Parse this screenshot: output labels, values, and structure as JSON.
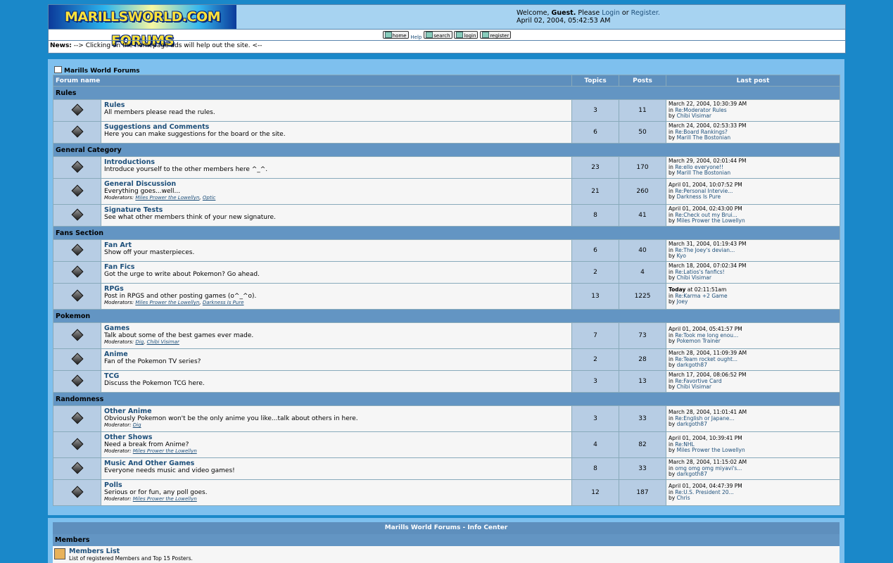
{
  "header": {
    "logo_text": "MARILLSWORLD.COM FORUMS",
    "welcome_prefix": "Welcome,",
    "guest": "Guest.",
    "please": "Please",
    "login": "Login",
    "or": "or",
    "register": "Register.",
    "date": "April 02, 2004, 05:42:53 AM"
  },
  "toolbar": {
    "home": "home",
    "help": "Help",
    "search": "search",
    "login": "login",
    "register": "register"
  },
  "news": {
    "label": "News:",
    "text": "--> Clicking on the homepage ads will help out the site. <--"
  },
  "board": {
    "title": "Marills World Forums",
    "columns": {
      "name": "Forum name",
      "topics": "Topics",
      "posts": "Posts",
      "last": "Last post"
    },
    "categories": [
      {
        "name": "Rules",
        "forums": [
          {
            "name": "Rules",
            "desc": "All members please read the rules.",
            "topics": "3",
            "posts": "11",
            "last_date": "March 22, 2004, 10:30:39 AM",
            "last_in": "Re:Moderator Rules",
            "last_by": "Chibi Visimar"
          },
          {
            "name": "Suggestions and Comments",
            "desc": "Here you can make suggestions for the board or the site.",
            "topics": "6",
            "posts": "50",
            "last_date": "March 24, 2004, 02:53:33 PM",
            "last_in": "Re:Board Rankings?",
            "last_by": "Marill The Bostonian"
          }
        ]
      },
      {
        "name": "General Category",
        "forums": [
          {
            "name": "Introductions",
            "desc": "Introduce yourself to the other members here ^_^.",
            "topics": "23",
            "posts": "170",
            "last_date": "March 29, 2004, 02:01:44 PM",
            "last_in": "Re:ello everyone!!",
            "last_by": "Marill The Bostonian"
          },
          {
            "name": "General Discussion",
            "desc": "Everything goes...well...",
            "mod_label": "Moderators:",
            "mods": [
              "Miles Prower the Lowellyn",
              "Optic"
            ],
            "topics": "21",
            "posts": "260",
            "last_date": "April 01, 2004, 10:07:52 PM",
            "last_in": "Re:Personal Intervie...",
            "last_by": "Darkness Is Pure"
          },
          {
            "name": "Signature Tests",
            "desc": "See what other members think of your new signature.",
            "topics": "8",
            "posts": "41",
            "last_date": "April 01, 2004, 02:43:00 PM",
            "last_in": "Re:Check out my Brui...",
            "last_by": "Miles Prower the Lowellyn"
          }
        ]
      },
      {
        "name": "Fans Section",
        "forums": [
          {
            "name": "Fan Art",
            "desc": "Show off your masterpieces.",
            "topics": "6",
            "posts": "40",
            "last_date": "March 31, 2004, 01:19:43 PM",
            "last_in": "Re:The Joey's devian...",
            "last_by": "Kyo"
          },
          {
            "name": "Fan Fics",
            "desc": "Got the urge to write about Pokemon? Go ahead.",
            "topics": "2",
            "posts": "4",
            "last_date": "March 18, 2004, 07:02:34 PM",
            "last_in": "Re:Latios's fanfics!",
            "last_by": "Chibi Visimar"
          },
          {
            "name": "RPGs",
            "desc": "Post in RPGS and other posting games (o^_^o).",
            "mod_label": "Moderators:",
            "mods": [
              "Miles Prower the Lowellyn",
              "Darkness Is Pure"
            ],
            "topics": "13",
            "posts": "1225",
            "last_today": "Today",
            "last_date": "at 02:11:51am",
            "last_in": "Re:Karma +2 Game",
            "last_by": "Joey"
          }
        ]
      },
      {
        "name": "Pokemon",
        "forums": [
          {
            "name": "Games",
            "desc": "Talk about some of the best games ever made.",
            "mod_label": "Moderators:",
            "mods": [
              "Dig",
              "Chibi Visimar"
            ],
            "topics": "7",
            "posts": "73",
            "last_date": "April 01, 2004, 05:41:57 PM",
            "last_in": "Re:Took me long enou...",
            "last_by": "Pokemon Trainer"
          },
          {
            "name": "Anime",
            "desc": "Fan of the Pokemon TV series?",
            "topics": "2",
            "posts": "28",
            "last_date": "March 28, 2004, 11:09:39 AM",
            "last_in": "Re:Team rocket ought...",
            "last_by": "darkgoth87"
          },
          {
            "name": "TCG",
            "desc": "Discuss the Pokemon TCG here.",
            "topics": "3",
            "posts": "13",
            "last_date": "March 17, 2004, 08:06:52 PM",
            "last_in": "Re:Favortive Card",
            "last_by": "Chibi Visimar"
          }
        ]
      },
      {
        "name": "Randomness",
        "forums": [
          {
            "name": "Other Anime",
            "desc": "Obviously Pokemon won't be the only anime you like...talk about others in here.",
            "mod_label": "Moderator:",
            "mods": [
              "Dig"
            ],
            "topics": "3",
            "posts": "33",
            "last_date": "March 28, 2004, 11:01:41 AM",
            "last_in": "Re:English or Japane...",
            "last_by": "darkgoth87"
          },
          {
            "name": "Other Shows",
            "desc": "Need a break from Anime?",
            "mod_label": "Moderator:",
            "mods": [
              "Miles Prower the Lowellyn"
            ],
            "topics": "4",
            "posts": "82",
            "last_date": "April 01, 2004, 10:39:41 PM",
            "last_in": "Re:NHL",
            "last_by": "Miles Prower the Lowellyn"
          },
          {
            "name": "Music And Other Games",
            "desc": "Everyone needs music and video games!",
            "topics": "8",
            "posts": "33",
            "last_date": "March 28, 2004, 11:15:02 AM",
            "last_in": "omg omg omg miyavi's...",
            "last_by": "darkgoth87"
          },
          {
            "name": "Polls",
            "desc": "Serious or for fun, any poll goes.",
            "mod_label": "Moderator:",
            "mods": [
              "Miles Prower the Lowellyn"
            ],
            "topics": "12",
            "posts": "187",
            "last_date": "April 01, 2004, 04:47:39 PM",
            "last_in": "Re:U.S. President 20...",
            "last_by": "Chris"
          }
        ]
      }
    ],
    "in_label": "in",
    "by_label": "by"
  },
  "info_center": {
    "title": "Marills World Forums - Info Center",
    "category": "Members",
    "link": "Members List",
    "desc": "List of registered Members and Top 15 Posters."
  }
}
